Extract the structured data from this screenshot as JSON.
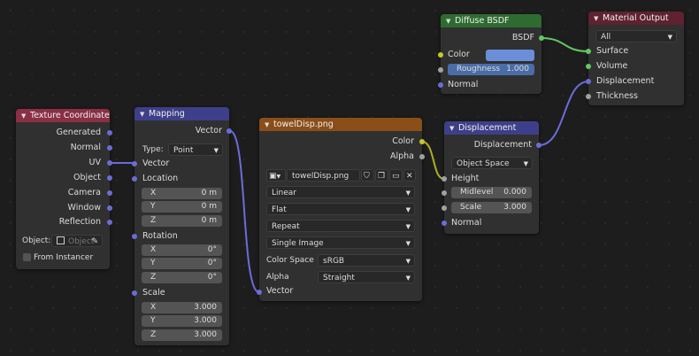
{
  "nodes": {
    "texture_coordinate": {
      "title": "Texture Coordinate",
      "outputs": [
        "Generated",
        "Normal",
        "UV",
        "Object",
        "Camera",
        "Window",
        "Reflection"
      ],
      "object_label": "Object:",
      "object_placeholder": "Object",
      "from_instancer": "From Instancer"
    },
    "mapping": {
      "title": "Mapping",
      "output": "Vector",
      "type_label": "Type:",
      "type_value": "Point",
      "input_vector": "Vector",
      "location_label": "Location",
      "location": [
        {
          "axis": "X",
          "value": "0 m"
        },
        {
          "axis": "Y",
          "value": "0 m"
        },
        {
          "axis": "Z",
          "value": "0 m"
        }
      ],
      "rotation_label": "Rotation",
      "rotation": [
        {
          "axis": "X",
          "value": "0°"
        },
        {
          "axis": "Y",
          "value": "0°"
        },
        {
          "axis": "Z",
          "value": "0°"
        }
      ],
      "scale_label": "Scale",
      "scale": [
        {
          "axis": "X",
          "value": "3.000"
        },
        {
          "axis": "Y",
          "value": "3.000"
        },
        {
          "axis": "Z",
          "value": "3.000"
        }
      ]
    },
    "image_texture": {
      "title": "towelDisp.png",
      "output_color": "Color",
      "output_alpha": "Alpha",
      "image_name": "towelDisp.png",
      "interpolation": "Linear",
      "projection": "Flat",
      "extension": "Repeat",
      "source": "Single Image",
      "color_space_label": "Color Space",
      "color_space": "sRGB",
      "alpha_label": "Alpha",
      "alpha_mode": "Straight",
      "input_vector": "Vector"
    },
    "diffuse": {
      "title": "Diffuse BSDF",
      "output": "BSDF",
      "color_label": "Color",
      "color_swatch": "#6a8fd8",
      "roughness_label": "Roughness",
      "roughness_value": "1.000",
      "normal_label": "Normal"
    },
    "displacement": {
      "title": "Displacement",
      "output": "Displacement",
      "space": "Object Space",
      "height_label": "Height",
      "midlevel_label": "Midlevel",
      "midlevel_value": "0.000",
      "scale_label": "Scale",
      "scale_value": "3.000",
      "normal_label": "Normal"
    },
    "material_output": {
      "title": "Material Output",
      "target": "All",
      "inputs": [
        "Surface",
        "Volume",
        "Displacement",
        "Thickness"
      ]
    }
  },
  "colors": {
    "background": "#1d1d1d",
    "node_body": "#303030",
    "header_input": "#8a2f45",
    "header_vector": "#3e3f8a",
    "header_texture": "#8a4e18",
    "header_shader": "#2e6b30",
    "header_output": "#5e2230",
    "socket_vector": "#6c6cd8",
    "socket_color": "#c7c729",
    "socket_float": "#a1a1a1",
    "socket_shader": "#63c763"
  }
}
